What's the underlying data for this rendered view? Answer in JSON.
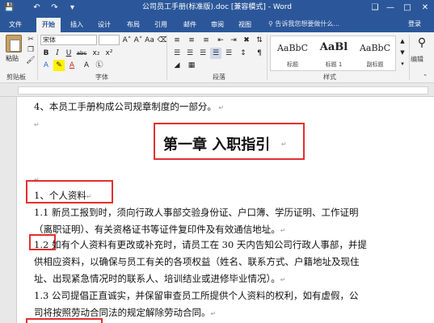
{
  "window": {
    "title": "公司员工手册(标准版).doc [兼容模式] - Word",
    "controls": [
      "restore",
      "minimize",
      "maximize",
      "close"
    ]
  },
  "quick_access": {
    "icons": [
      "save-icon",
      "undo-icon",
      "redo-icon",
      "customize-icon"
    ]
  },
  "tabs": [
    {
      "label": "文件",
      "active": false
    },
    {
      "label": "开始",
      "active": true
    },
    {
      "label": "插入",
      "active": false
    },
    {
      "label": "设计",
      "active": false
    },
    {
      "label": "布局",
      "active": false
    },
    {
      "label": "引用",
      "active": false
    },
    {
      "label": "邮件",
      "active": false
    },
    {
      "label": "审阅",
      "active": false
    },
    {
      "label": "视图",
      "active": false
    }
  ],
  "tell_me": "告诉我您想要做什么...",
  "login_label": "登录",
  "ribbon": {
    "clipboard_label": "剪贴板",
    "paste_label": "粘贴",
    "font_group_label": "字体",
    "paragraph_group_label": "段落",
    "styles_group_label": "样式",
    "editing_label": "编辑",
    "font_name": "宋体",
    "font_size": "",
    "format_buttons": {
      "bold": "B",
      "italic": "I",
      "underline": "U",
      "strike": "abc",
      "subscript": "x₂",
      "superscript": "x²"
    },
    "styles": [
      {
        "sample": "AaBbC",
        "name": "标题",
        "selected": false
      },
      {
        "sample": "AaBl",
        "name": "标题 1",
        "selected": false
      },
      {
        "sample": "AaBbC",
        "name": "副标题",
        "selected": false
      }
    ]
  },
  "document": {
    "intro": "4、本员工手册构成公司规章制度的一部分。",
    "chapter_title": "第一章  入职指引",
    "section_title": "1、个人资料",
    "lines": [
      "1.1  新员工报到时，须向行政人事部交验身份证、户口簿、学历证明、工作证明",
      "（离职证明）、有关资格证书等证件复印件及有效通信地址。",
      "如有个人资料有更改或补充时，请员工在  30 天内告知公司行政人事部，并提",
      "供相应资料，以确保与员工有关的各项权益（姓名、联系方式、户籍地址及现住",
      "址、出现紧急情况时的联系人、培训结业或进修毕业情况）。",
      "1.3  公司提倡正直诚实，并保留审查员工所提供个人资料的权利，如有虚假，公",
      "司将按照劳动合同法的规定解除劳动合同。"
    ],
    "num_1_2": "1.2"
  }
}
